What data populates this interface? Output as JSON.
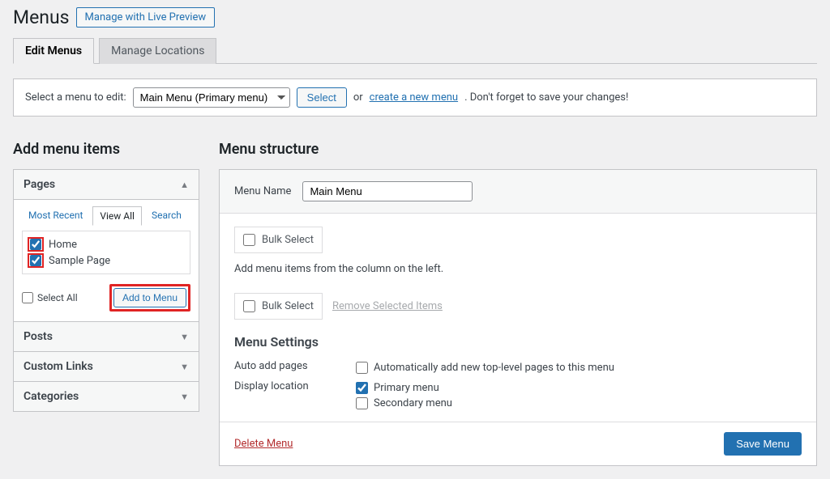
{
  "header": {
    "title": "Menus",
    "live_preview": "Manage with Live Preview"
  },
  "tabs": {
    "edit": "Edit Menus",
    "locations": "Manage Locations"
  },
  "select_bar": {
    "label": "Select a menu to edit:",
    "dropdown": "Main Menu (Primary menu)",
    "select_btn": "Select",
    "or": "or",
    "create_link": "create a new menu",
    "tail": ". Don't forget to save your changes!"
  },
  "left": {
    "heading": "Add menu items",
    "panels": {
      "pages": {
        "title": "Pages",
        "tabs": {
          "recent": "Most Recent",
          "view_all": "View All",
          "search": "Search"
        },
        "items": [
          "Home",
          "Sample Page"
        ],
        "select_all": "Select All",
        "add_btn": "Add to Menu"
      },
      "posts": "Posts",
      "custom_links": "Custom Links",
      "categories": "Categories"
    }
  },
  "right": {
    "heading": "Menu structure",
    "menu_name_label": "Menu Name",
    "menu_name_value": "Main Menu",
    "bulk_select": "Bulk Select",
    "helper": "Add menu items from the column on the left.",
    "remove_selected": "Remove Selected Items",
    "settings_title": "Menu Settings",
    "auto_add_label": "Auto add pages",
    "auto_add_option": "Automatically add new top-level pages to this menu",
    "display_label": "Display location",
    "display_options": {
      "primary": "Primary menu",
      "secondary": "Secondary menu"
    },
    "delete": "Delete Menu",
    "save": "Save Menu"
  }
}
